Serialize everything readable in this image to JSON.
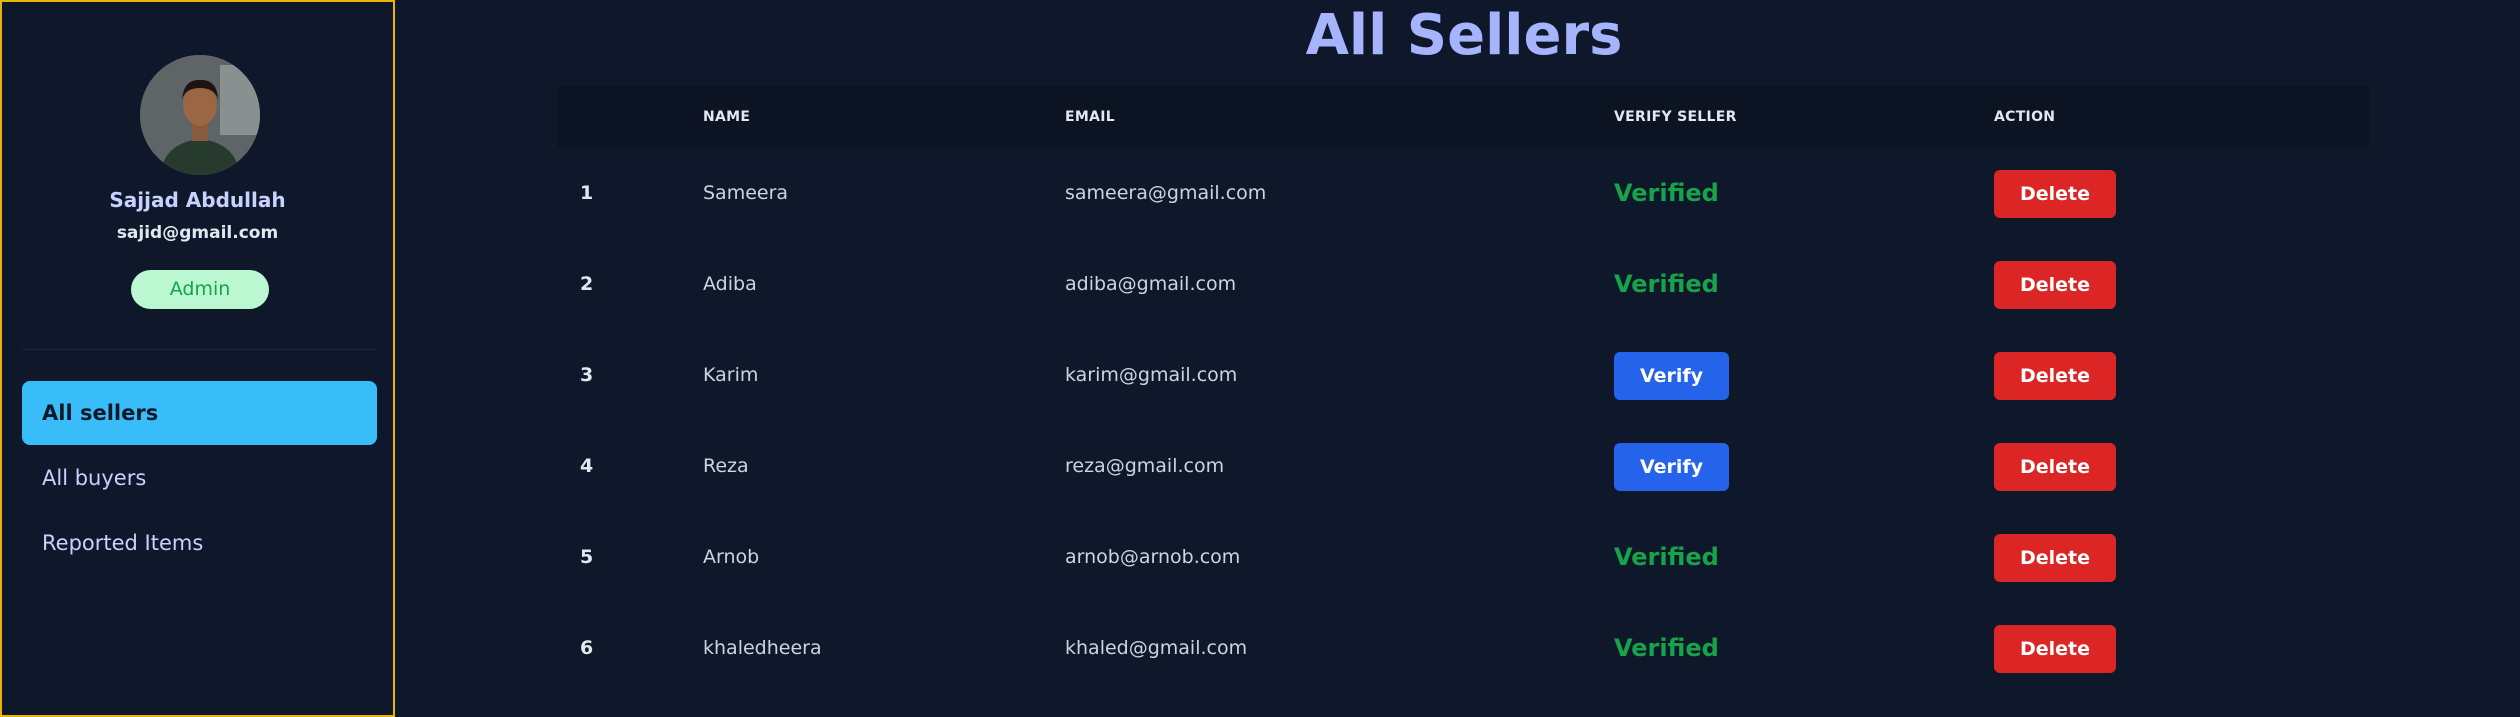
{
  "sidebar": {
    "profile": {
      "name": "Sajjad Abdullah",
      "email": "sajid@gmail.com",
      "role": "Admin"
    },
    "nav": [
      {
        "label": "All sellers",
        "active": true
      },
      {
        "label": "All buyers",
        "active": false
      },
      {
        "label": "Reported Items",
        "active": false
      }
    ]
  },
  "main": {
    "title": "All Sellers",
    "columns": [
      "",
      "NAME",
      "EMAIL",
      "VERIFY SELLER",
      "ACTION"
    ],
    "rows": [
      {
        "num": "1",
        "name": "Sameera",
        "email": "sameera@gmail.com",
        "status": "Verified",
        "action": "Delete"
      },
      {
        "num": "2",
        "name": "Adiba",
        "email": "adiba@gmail.com",
        "status": "Verified",
        "action": "Delete"
      },
      {
        "num": "3",
        "name": "Karim",
        "email": "karim@gmail.com",
        "status": "Verify",
        "action": "Delete"
      },
      {
        "num": "4",
        "name": "Reza",
        "email": "reza@gmail.com",
        "status": "Verify",
        "action": "Delete"
      },
      {
        "num": "5",
        "name": "Arnob",
        "email": "arnob@arnob.com",
        "status": "Verified",
        "action": "Delete"
      },
      {
        "num": "6",
        "name": "khaledheera",
        "email": "khaled@gmail.com",
        "status": "Verified",
        "action": "Delete"
      }
    ]
  },
  "colors": {
    "background": "#0f172a",
    "sidebar_border": "#eab308",
    "active_nav": "#38bdf8",
    "verified": "#16a34a",
    "verify_button": "#2563eb",
    "delete_button": "#dc2626",
    "title": "#a5b4fc"
  }
}
